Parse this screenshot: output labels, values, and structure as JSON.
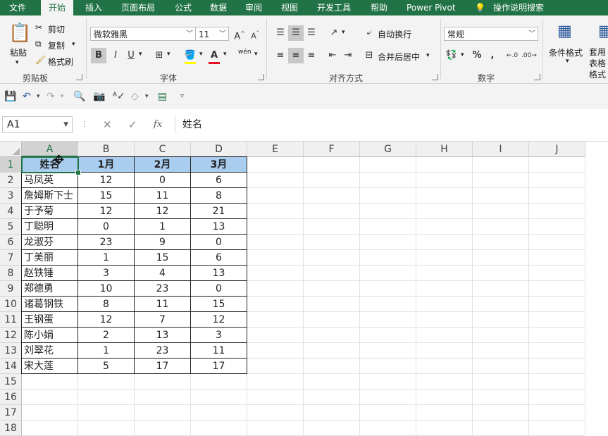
{
  "menu": {
    "tabs": [
      "文件",
      "开始",
      "插入",
      "页面布局",
      "公式",
      "数据",
      "审阅",
      "视图",
      "开发工具",
      "帮助",
      "Power Pivot"
    ],
    "active": "开始",
    "tell_me": "操作说明搜索"
  },
  "ribbon": {
    "clipboard": {
      "label": "剪贴板",
      "paste": "粘贴",
      "cut": "剪切",
      "copy": "复制",
      "format_painter": "格式刷"
    },
    "font": {
      "label": "字体",
      "font_name": "微软雅黑",
      "font_size": "11",
      "bold": "B",
      "italic": "I",
      "underline": "U",
      "phonetic": "wén"
    },
    "alignment": {
      "label": "对齐方式",
      "wrap_text": "自动换行",
      "merge_center": "合并后居中"
    },
    "number": {
      "label": "数字",
      "format": "常规",
      "percent": "%",
      "comma": ","
    },
    "styles": {
      "conditional_format": "条件格式",
      "table_format": "套用表格格式"
    }
  },
  "formula_bar": {
    "name_box": "A1",
    "fx": "fx",
    "content": "姓名"
  },
  "sheet": {
    "columns": [
      "A",
      "B",
      "C",
      "D",
      "E",
      "F",
      "G",
      "H",
      "I",
      "J"
    ],
    "row_numbers": [
      "1",
      "2",
      "3",
      "4",
      "5",
      "6",
      "7",
      "8",
      "9",
      "10",
      "11",
      "12",
      "13",
      "14",
      "15",
      "16",
      "17",
      "18"
    ],
    "header": [
      "姓名",
      "1月",
      "2月",
      "3月"
    ],
    "rows": [
      [
        "马凤英",
        "12",
        "0",
        "6"
      ],
      [
        "詹姆斯下士",
        "15",
        "11",
        "8"
      ],
      [
        "于予菊",
        "12",
        "12",
        "21"
      ],
      [
        "丁聪明",
        "0",
        "1",
        "13"
      ],
      [
        "龙淑芬",
        "23",
        "9",
        "0"
      ],
      [
        "丁美丽",
        "1",
        "15",
        "6"
      ],
      [
        "赵铁锤",
        "3",
        "4",
        "13"
      ],
      [
        "郑德勇",
        "10",
        "23",
        "0"
      ],
      [
        "诸葛钢铁",
        "8",
        "11",
        "15"
      ],
      [
        "王钢蛋",
        "12",
        "7",
        "12"
      ],
      [
        "陈小娟",
        "2",
        "13",
        "3"
      ],
      [
        "刘翠花",
        "1",
        "23",
        "11"
      ],
      [
        "宋大莲",
        "5",
        "17",
        "17"
      ]
    ]
  },
  "colors": {
    "brand": "#217346",
    "header_fill": "#a8cdee",
    "font_color_red": "#e81123",
    "fill_yellow": "#ffff00"
  }
}
